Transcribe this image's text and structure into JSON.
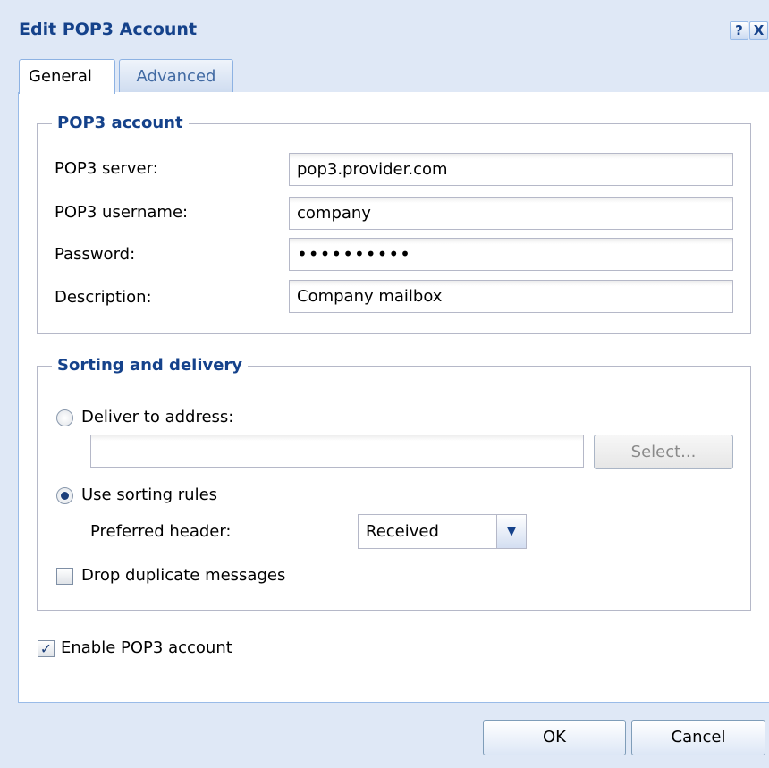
{
  "dialog": {
    "title": "Edit POP3 Account",
    "help_icon": "?",
    "close_icon": "X"
  },
  "tabs": [
    {
      "label": "General",
      "active": true
    },
    {
      "label": "Advanced",
      "active": false
    }
  ],
  "pop3_account": {
    "legend": "POP3 account",
    "server_label": "POP3 server:",
    "server_value": "pop3.provider.com",
    "username_label": "POP3 username:",
    "username_value": "company",
    "password_label": "Password:",
    "password_value": "••••••••••",
    "description_label": "Description:",
    "description_value": "Company mailbox"
  },
  "sorting": {
    "legend": "Sorting and delivery",
    "deliver_label": "Deliver to address:",
    "deliver_value": "",
    "deliver_checked": false,
    "select_button": "Select...",
    "use_rules_label": "Use sorting rules",
    "use_rules_checked": true,
    "preferred_header_label": "Preferred header:",
    "preferred_header_value": "Received",
    "drop_duplicates_label": "Drop duplicate messages",
    "drop_duplicates_checked": false
  },
  "enable": {
    "label": "Enable POP3 account",
    "checked": true,
    "check_glyph": "✓"
  },
  "footer": {
    "ok_label": "OK",
    "cancel_label": "Cancel"
  },
  "colors": {
    "title": "#15428b",
    "background": "#dfe8f6",
    "border": "#99bbe8"
  }
}
